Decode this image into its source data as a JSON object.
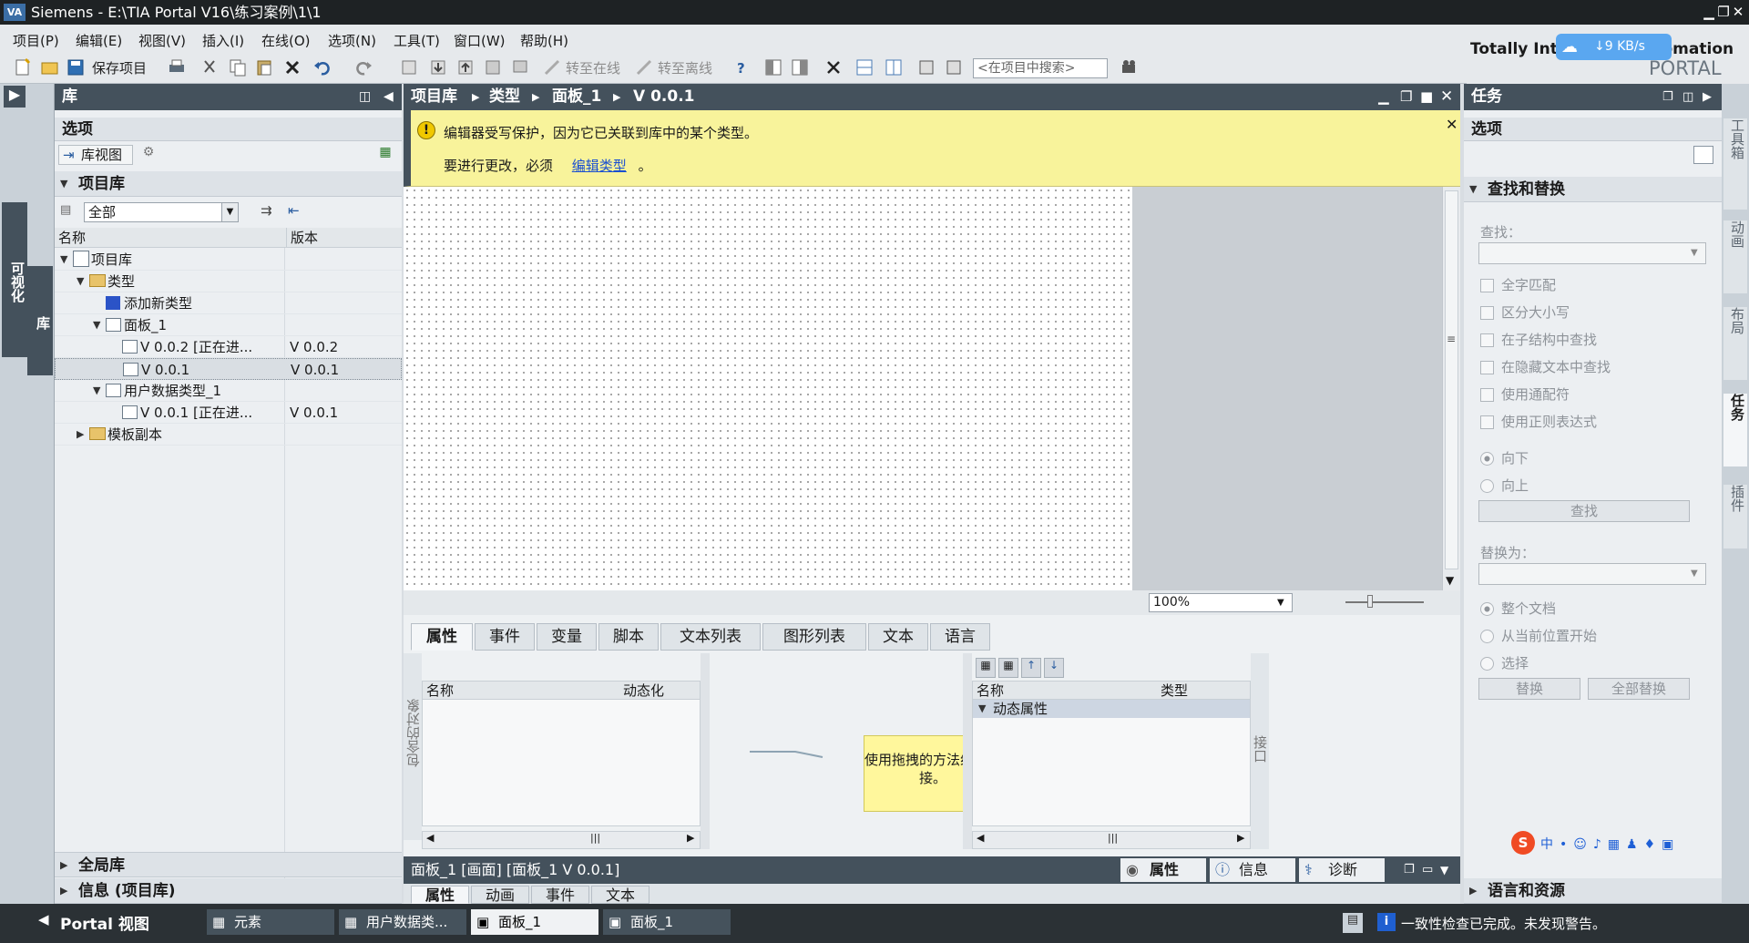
{
  "window": {
    "logo": "VA",
    "title": "Siemens  -  E:\\TIA Portal V16\\练习案例\\1\\1"
  },
  "menu": [
    "项目(P)",
    "编辑(E)",
    "视图(V)",
    "插入(I)",
    "在线(O)",
    "选项(N)",
    "工具(T)",
    "窗口(W)",
    "帮助(H)"
  ],
  "toolbar": {
    "save_label": "保存项目",
    "go_online": "转至在线",
    "go_offline": "转至离线",
    "search_placeholder": "<在项目中搜索>"
  },
  "brand": {
    "line1": "Totally Integrated Automation",
    "line2": "PORTAL",
    "net_speed": "↓9 KB/s"
  },
  "left_strip": {
    "tab1": "可视化",
    "tab2": "库"
  },
  "library": {
    "header": "库",
    "options": "选项",
    "library_view": "库视图",
    "project_library": "项目库",
    "filter_value": "全部",
    "col_name": "名称",
    "col_version": "版本",
    "tree": [
      {
        "label": "项目库",
        "version": ""
      },
      {
        "label": "类型",
        "version": ""
      },
      {
        "label": "添加新类型",
        "version": ""
      },
      {
        "label": "面板_1",
        "version": ""
      },
      {
        "label": "V 0.0.2 [正在进...",
        "version": "V 0.0.2"
      },
      {
        "label": "V 0.0.1",
        "version": "V 0.0.1"
      },
      {
        "label": "用户数据类型_1",
        "version": ""
      },
      {
        "label": "V 0.0.1 [正在进...",
        "version": "V 0.0.1"
      },
      {
        "label": "模板副本",
        "version": ""
      }
    ],
    "global_library": "全局库",
    "info": "信息 (项目库)"
  },
  "editor": {
    "breadcrumb": [
      "项目库",
      "类型",
      "面板_1",
      "V 0.0.1"
    ],
    "warning_line1": "编辑器受写保护，因为它已关联到库中的某个类型。",
    "warning_line2": "要进行更改，必须",
    "warning_link": "编辑类型",
    "warning_end": "。",
    "zoom": "100%"
  },
  "inspector": {
    "tabs": [
      "属性",
      "事件",
      "变量",
      "脚本",
      "文本列表",
      "图形列表",
      "文本",
      "语言"
    ],
    "left_vertical": "包含的对象",
    "left_col_name": "名称",
    "left_col_dyn": "动态化",
    "hint": "使用拖拽的方法组态连接。",
    "right_col_name": "名称",
    "right_col_type": "类型",
    "right_group": "动态属性",
    "right_vertical": "接口"
  },
  "status": {
    "title": "面板_1 [画面] [面板_1 V 0.0.1]",
    "tab_props": "属性",
    "tab_info": "信息",
    "tab_diag": "诊断",
    "bottom_tabs": [
      "属性",
      "动画",
      "事件",
      "文本"
    ]
  },
  "tasks": {
    "header": "任务",
    "options": "选项",
    "find_replace": "查找和替换",
    "find_label": "查找：",
    "checkboxes": [
      "全字匹配",
      "区分大小写",
      "在子结构中查找",
      "在隐藏文本中查找",
      "使用通配符",
      "使用正则表达式"
    ],
    "dir_down": "向下",
    "dir_up": "向上",
    "find_button": "查找",
    "replace_label": "替换为：",
    "scope": [
      "整个文档",
      "从当前位置开始",
      "选择"
    ],
    "replace_button": "替换",
    "replace_all_button": "全部替换",
    "language": "语言和资源"
  },
  "right_strip": [
    "工具箱",
    "动画",
    "布局",
    "任务",
    "插件"
  ],
  "taskbar": {
    "portal_view": "Portal 视图",
    "tasks": [
      "元素",
      "用户数据类...",
      "面板_1",
      "面板_1"
    ],
    "status_msg": "一致性检查已完成。未发现警告。"
  }
}
